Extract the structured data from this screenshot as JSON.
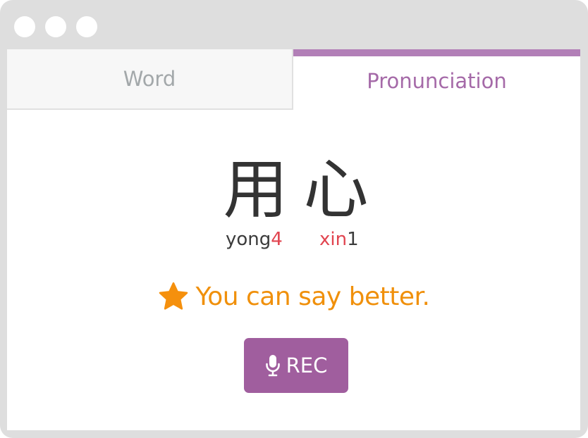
{
  "tabs": {
    "word_label": "Word",
    "pronunciation_label": "Pronunciation"
  },
  "word": {
    "chars": [
      "用",
      "心"
    ],
    "pinyin": [
      {
        "syllable": "yong",
        "tone": "4"
      },
      {
        "syllable": "xin",
        "tone": "1"
      }
    ]
  },
  "feedback": {
    "icon": "star-icon",
    "text": "You can say better."
  },
  "rec_button": {
    "icon": "microphone-icon",
    "label": "REC"
  },
  "colors": {
    "accent": "#a05e9e",
    "feedback": "#f0900b",
    "tone_highlight": "#e1444f"
  }
}
